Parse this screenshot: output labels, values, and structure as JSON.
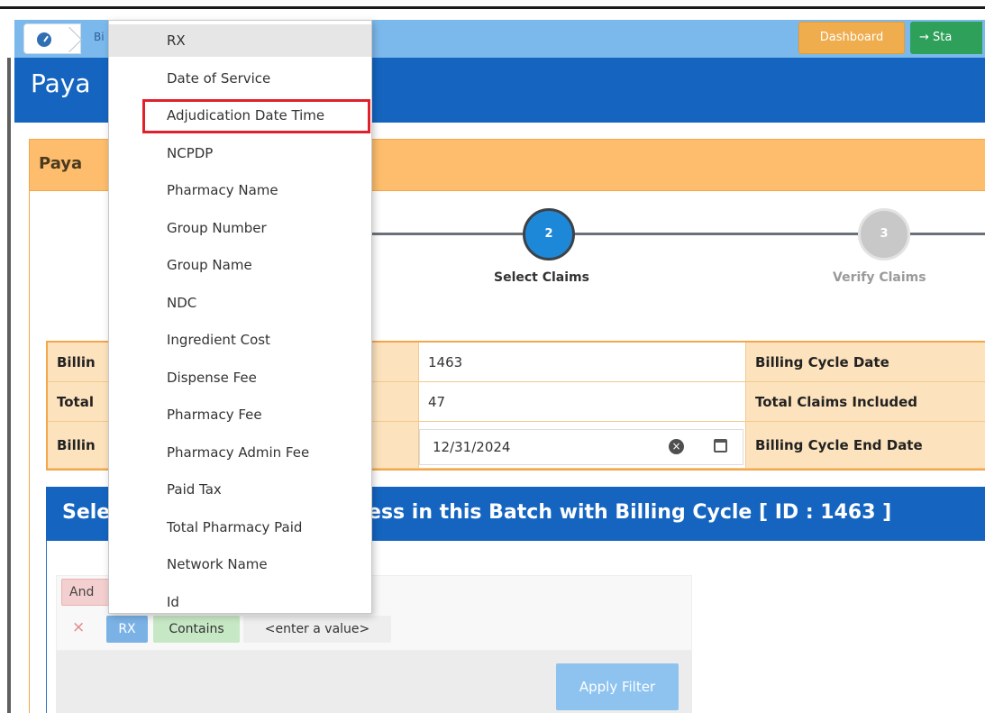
{
  "breadcrumb": {
    "current": "Bi"
  },
  "header": {
    "title": "Paya",
    "dashboard_label": "Dashboard",
    "start_label": "→ Sta"
  },
  "panel": {
    "title": "Paya"
  },
  "stepper": {
    "steps": [
      {
        "number": "2",
        "label": "Select Claims"
      },
      {
        "number": "3",
        "label": "Verify Claims"
      }
    ]
  },
  "info_table": {
    "rows": [
      {
        "left_label": "Billin",
        "value": "1463",
        "right_label": "Billing Cycle Date"
      },
      {
        "left_label": "Total",
        "value": "47",
        "right_label": "Total Claims Included"
      },
      {
        "left_label": "Billin",
        "value": "12/31/2024",
        "right_label": "Billing Cycle End Date"
      }
    ]
  },
  "section": {
    "title_prefix": "Sele",
    "title_suffix": "cess in this Batch with Billing Cycle [ ID : 1463 ]"
  },
  "filter": {
    "group_operator": "And",
    "remove_symbol": "×",
    "field": "RX",
    "operator": "Contains",
    "value_placeholder": "<enter a value>",
    "apply_label": "Apply Filter"
  },
  "dropdown": {
    "items": [
      "RX",
      "Date of Service",
      "Adjudication Date Time",
      "NCPDP",
      "Pharmacy Name",
      "Group Number",
      "Group Name",
      "NDC",
      "Ingredient Cost",
      "Dispense Fee",
      "Pharmacy Fee",
      "Pharmacy Admin Fee",
      "Paid Tax",
      "Total Pharmacy Paid",
      "Network Name",
      "Id"
    ],
    "selected_index": 0,
    "highlighted_index": 2
  },
  "colors": {
    "header_blue": "#1565c0",
    "breadcrumb_blue": "#7bb9ec",
    "panel_orange": "#fdbd6c",
    "highlight_red": "#e0212c",
    "dashboard_orange": "#f0ad4e",
    "start_green": "#2ea05a"
  }
}
